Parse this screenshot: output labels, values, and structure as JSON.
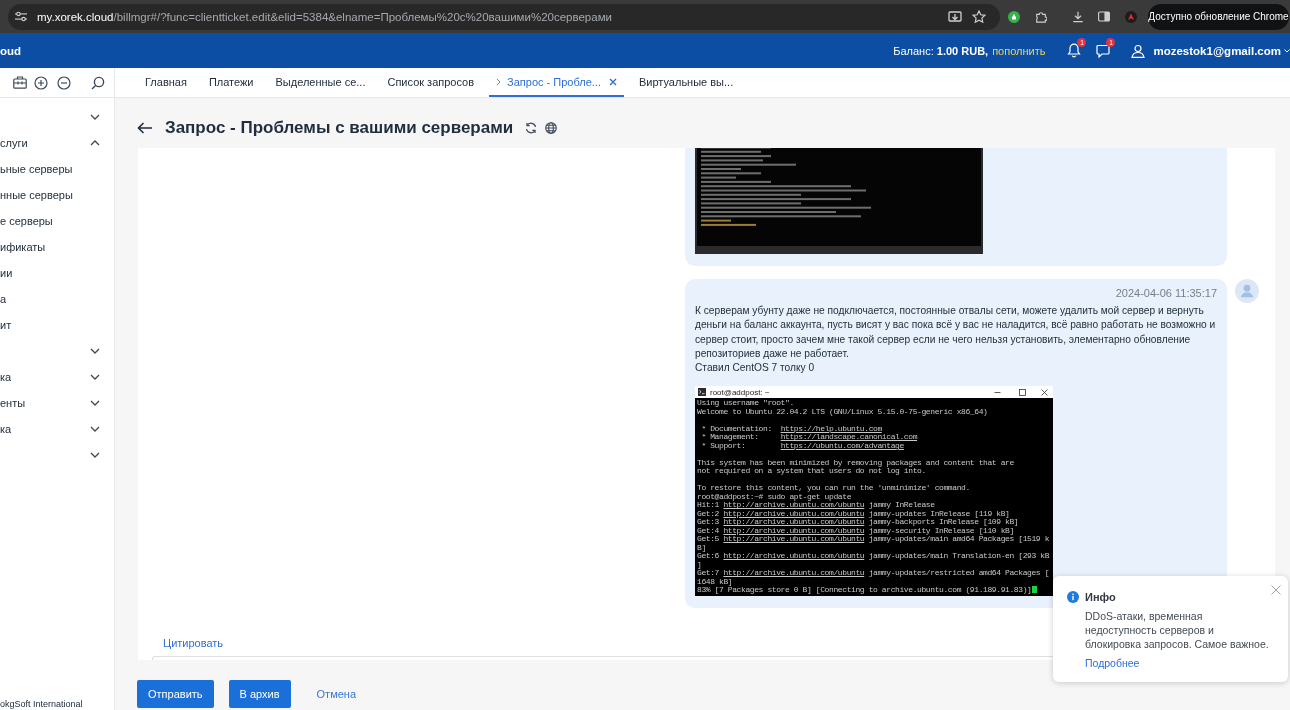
{
  "browser": {
    "url_host": "my.xorek.cloud",
    "url_path": "/billmgr#/?func=clientticket.edit&elid=5384&elname=Проблемы%20c%20вашими%20серверами",
    "update_button": "Доступно обновление Chrome"
  },
  "header": {
    "brand": "oud",
    "balance": "Баланс: **1.00 RUB,**",
    "top_up": "пополнить",
    "notifications": [
      {
        "kind": "bell",
        "count": "1"
      },
      {
        "kind": "chat",
        "count": "1"
      }
    ],
    "user": "mozestok1@gmail.com"
  },
  "tabs": [
    {
      "label": "Главная",
      "selected": false,
      "nested": false,
      "closable": false
    },
    {
      "label": "Платежи",
      "selected": false,
      "nested": false,
      "closable": false
    },
    {
      "label": "Выделенные се...",
      "selected": false,
      "nested": false,
      "closable": false
    },
    {
      "label": "Список запросов",
      "selected": false,
      "nested": false,
      "closable": false
    },
    {
      "label": "Запрос - Пробле...",
      "selected": true,
      "nested": true,
      "closable": true
    },
    {
      "label": "Виртуальные вы...",
      "selected": false,
      "nested": false,
      "closable": false
    }
  ],
  "sidebar": {
    "items": [
      {
        "expanded": false
      },
      {
        "label": "слуги",
        "expanded": true,
        "children": [
          {
            "label": "ьные серверы"
          },
          {
            "label": "нные серверы"
          },
          {
            "label": "е серверы"
          },
          {
            "label": "ификаты"
          },
          {
            "label": "ии"
          },
          {
            "label": "а"
          },
          {
            "label": "ит"
          }
        ]
      },
      {
        "expanded": false
      },
      {
        "label": "ка",
        "expanded": false
      },
      {
        "label": "енты",
        "expanded": false
      },
      {
        "label": "ка",
        "expanded": false
      },
      {
        "expanded": false
      }
    ],
    "footer": "okgSoft International"
  },
  "page": {
    "title": "Запрос - Проблемы с вашими серверами"
  },
  "messages": [
    {
      "avatar": false,
      "attachments": [
        {
          "kind": "terminal_blurred"
        }
      ]
    },
    {
      "avatar": true,
      "time": "2024-04-06 11:35:17",
      "paragraphs": [
        "К серверам убунту даже не подключается, постоянные отвалы сети, можете удалить мой сервер и вернуть деньги на баланс аккаунта, пусть висят у вас пока всё у вас не наладится, всё равно работать не возможно и сервер стоит, просто зачем мне такой сервер если не чего нельзя установить, элементарно обновление репозиториев даже не работает.",
        "Ставил CentOS 7 толку 0"
      ],
      "attachments": [
        {
          "kind": "terminal",
          "title": "root@addpost: ~",
          "cursor": true,
          "lines": [
            {
              "kind": "plain",
              "text": "Using username \"root\"."
            },
            {
              "kind": "plain",
              "text": "Welcome to Ubuntu 22.04.2 LTS (GNU/Linux 5.15.0-75-generic x86_64)"
            },
            {
              "kind": "blank"
            },
            {
              "kind": "link",
              "before": " * Documentation:  ",
              "url": "https://help.ubuntu.com"
            },
            {
              "kind": "link",
              "before": " * Management:     ",
              "url": "https://landscape.canonical.com"
            },
            {
              "kind": "link",
              "before": " * Support:        ",
              "url": "https://ubuntu.com/advantage"
            },
            {
              "kind": "blank"
            },
            {
              "kind": "plain",
              "text": "This system has been minimized by removing packages and content that are"
            },
            {
              "kind": "plain",
              "text": "not required on a system that users do not log into."
            },
            {
              "kind": "blank"
            },
            {
              "kind": "plain",
              "text": "To restore this content, you can run the 'unminimize' command."
            },
            {
              "kind": "plain",
              "text": "root@addpost:~# sudo apt-get update"
            },
            {
              "kind": "link",
              "before": "Hit:1 ",
              "url": "http://archive.ubuntu.com/ubuntu",
              "after": " jammy InRelease"
            },
            {
              "kind": "link",
              "before": "Get:2 ",
              "url": "http://archive.ubuntu.com/ubuntu",
              "after": " jammy-updates InRelease [119 kB]"
            },
            {
              "kind": "link",
              "before": "Get:3 ",
              "url": "http://archive.ubuntu.com/ubuntu",
              "after": " jammy-backports InRelease [109 kB]"
            },
            {
              "kind": "link",
              "before": "Get:4 ",
              "url": "http://archive.ubuntu.com/ubuntu",
              "after": " jammy-security InRelease [110 kB]"
            },
            {
              "kind": "link",
              "before": "Get:5 ",
              "url": "http://archive.ubuntu.com/ubuntu",
              "after": " jammy-updates/main amd64 Packages [1519 k"
            },
            {
              "kind": "plain",
              "text": "B]"
            },
            {
              "kind": "link",
              "before": "Get:6 ",
              "url": "http://archive.ubuntu.com/ubuntu",
              "after": " jammy-updates/main Translation-en [293 kB"
            },
            {
              "kind": "plain",
              "text": "]"
            },
            {
              "kind": "link",
              "before": "Get:7 ",
              "url": "http://archive.ubuntu.com/ubuntu",
              "after": " jammy-updates/restricted amd64 Packages ["
            },
            {
              "kind": "plain",
              "text": "1648 kB]"
            },
            {
              "kind": "plain",
              "text": "83% [7 Packages store 0 B] [Connecting to archive.ubuntu.com (91.189.91.83)]"
            }
          ]
        }
      ]
    }
  ],
  "quote_link": "Цитировать",
  "actions": [
    {
      "label": "Отправить",
      "kind": "primary"
    },
    {
      "label": "В архив",
      "kind": "primary"
    },
    {
      "label": "Отмена",
      "kind": "link"
    }
  ],
  "toast": {
    "title": "Инфо",
    "text": "DDoS-атаки, временная недоступность серверов и блокировка запросов. Самое важное.",
    "link": "Подробнее"
  }
}
